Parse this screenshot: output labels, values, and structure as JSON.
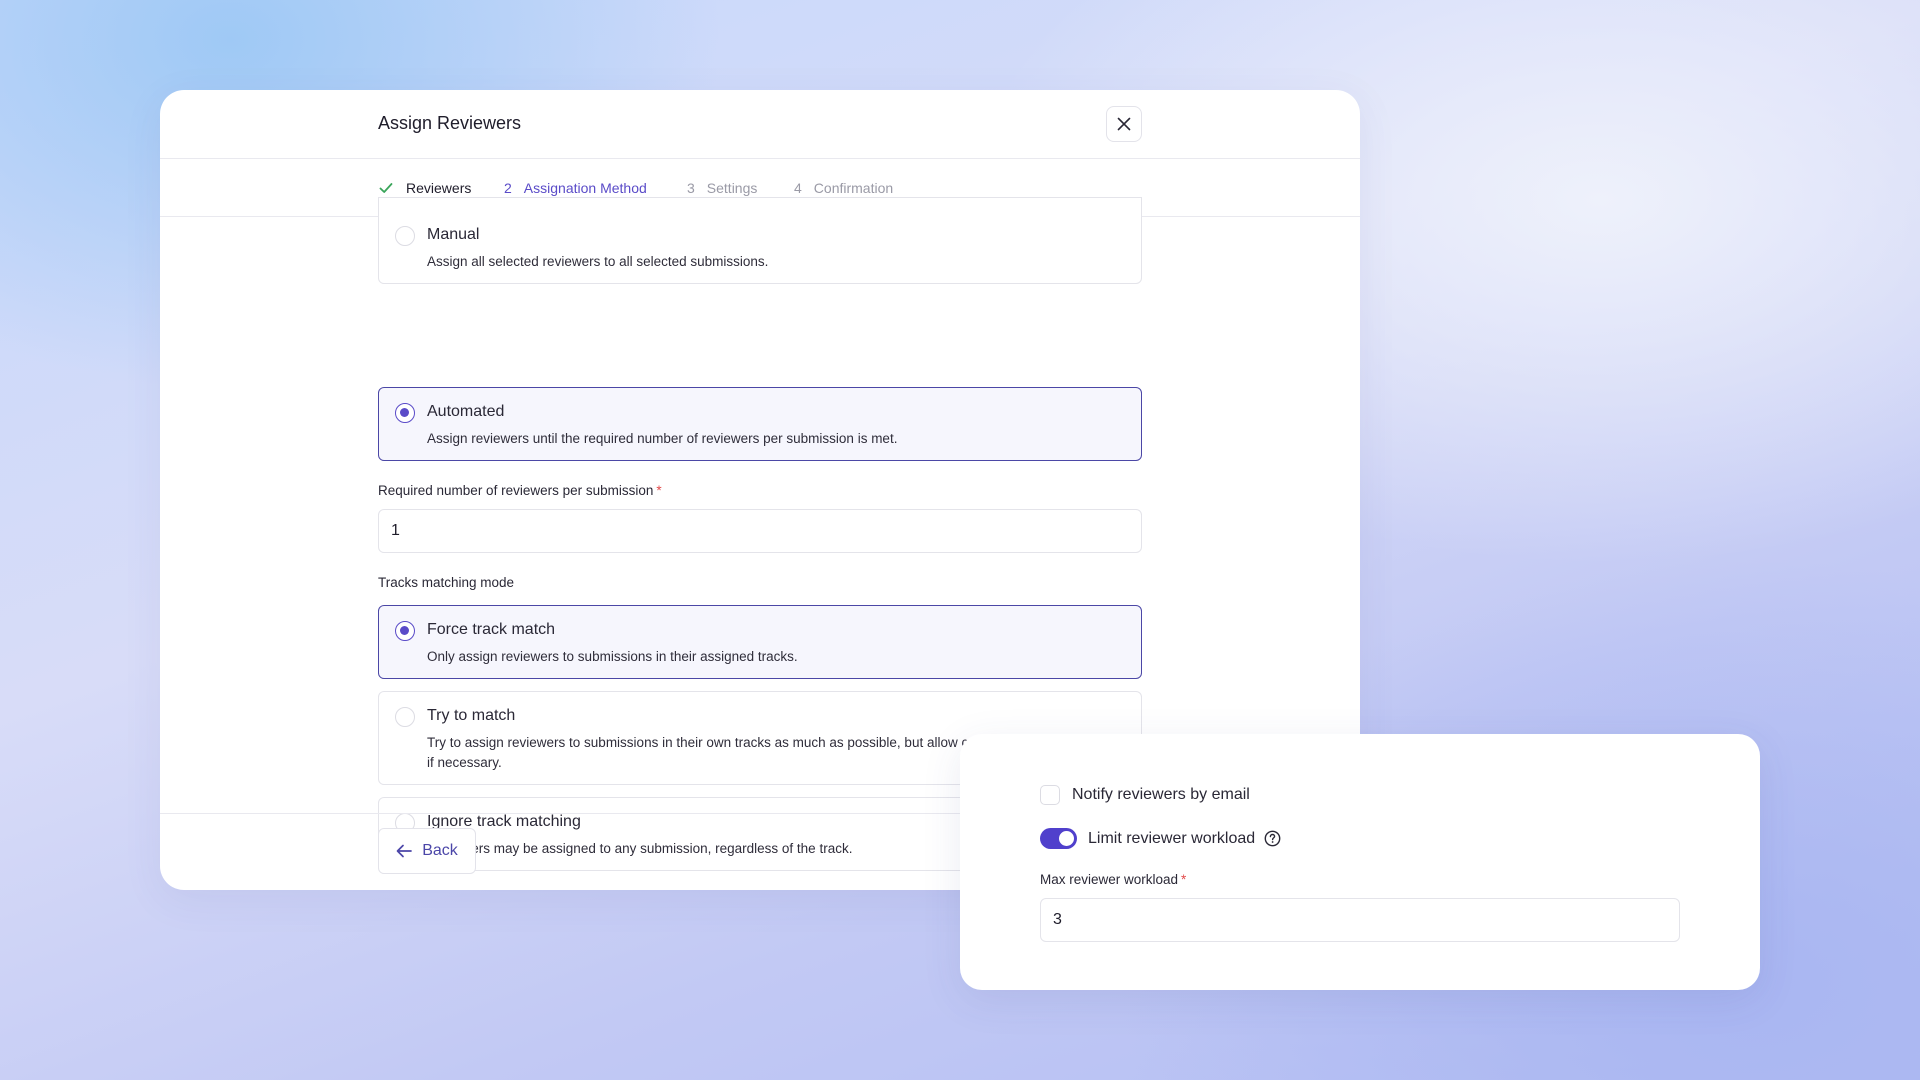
{
  "modal": {
    "title": "Assign Reviewers",
    "close_icon": "close-icon"
  },
  "stepper": {
    "steps": [
      {
        "number": "",
        "label": "Reviewers",
        "state": "done",
        "icon": "check-icon"
      },
      {
        "number": "2",
        "label": "Assignation Method",
        "state": "active"
      },
      {
        "number": "3",
        "label": "Settings",
        "state": "todo"
      },
      {
        "number": "4",
        "label": "Confirmation",
        "state": "todo"
      }
    ]
  },
  "assignment_method": {
    "options": [
      {
        "title": "Manual",
        "description": "Assign all selected reviewers to all selected submissions.",
        "selected": false
      },
      {
        "title": "Automated",
        "description": "Assign reviewers until the required number of reviewers per submission is met.",
        "selected": true
      }
    ]
  },
  "required_reviewers": {
    "label": "Required number of reviewers per submission",
    "required_mark": "*",
    "value": "1"
  },
  "tracks_matching": {
    "label": "Tracks matching mode",
    "options": [
      {
        "title": "Force track match",
        "description": "Only assign reviewers to submissions in their assigned tracks.",
        "selected": true
      },
      {
        "title": "Try to match",
        "description": "Try to assign reviewers to submissions in their own tracks as much as possible, but allow cross-track assignments if necessary.",
        "selected": false
      },
      {
        "title": "Ignore track matching",
        "description": "Reviewers may be assigned to any submission, regardless of the track.",
        "selected": false
      }
    ]
  },
  "footer": {
    "back_label": "Back",
    "back_icon": "arrow-left-icon"
  },
  "settings_card": {
    "notify_label": "Notify reviewers by email",
    "notify_checked": false,
    "limit_label": "Limit reviewer workload",
    "limit_enabled": true,
    "help_icon": "question-circle-icon",
    "max_label": "Max reviewer workload",
    "required_mark": "*",
    "max_value": "3"
  },
  "colors": {
    "accent": "#5a4bc8",
    "toggle_on": "#5040cc",
    "selected_border": "#4b47a6",
    "selected_bg": "#f6f6fd",
    "required": "#e24a4a"
  }
}
